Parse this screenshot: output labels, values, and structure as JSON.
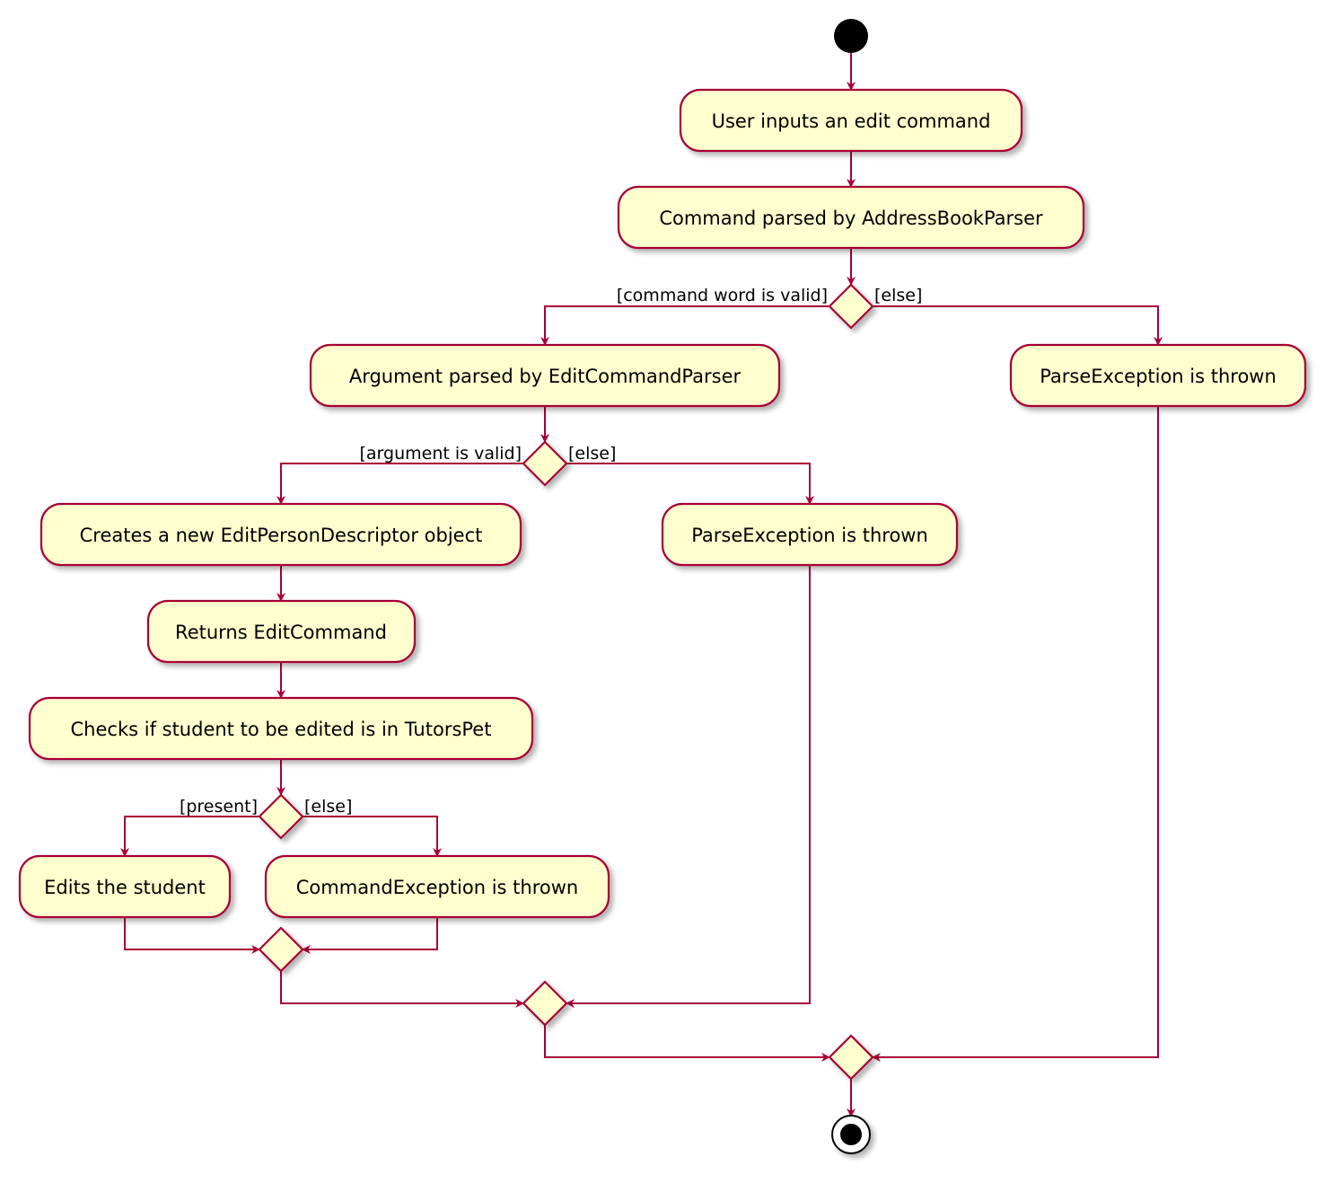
{
  "colors": {
    "border": "#A80036",
    "fill": "#FEFECE",
    "start": "#000000"
  },
  "activities": {
    "user_input": "User inputs an edit command",
    "command_parsed": "Command parsed by AddressBookParser",
    "argument_parsed": "Argument parsed by EditCommandParser",
    "parse_exception_1": "ParseException is thrown",
    "creates_descriptor": "Creates a new EditPersonDescriptor object",
    "parse_exception_2": "ParseException is thrown",
    "returns_command": "Returns EditCommand",
    "checks_student": "Checks if student to be edited is in TutorsPet",
    "edits_student": "Edits the student",
    "command_exception": "CommandException is thrown"
  },
  "guards": {
    "command_valid": "[command word is valid]",
    "command_else": "[else]",
    "argument_valid": "[argument is valid]",
    "argument_else": "[else]",
    "present": "[present]",
    "present_else": "[else]"
  }
}
